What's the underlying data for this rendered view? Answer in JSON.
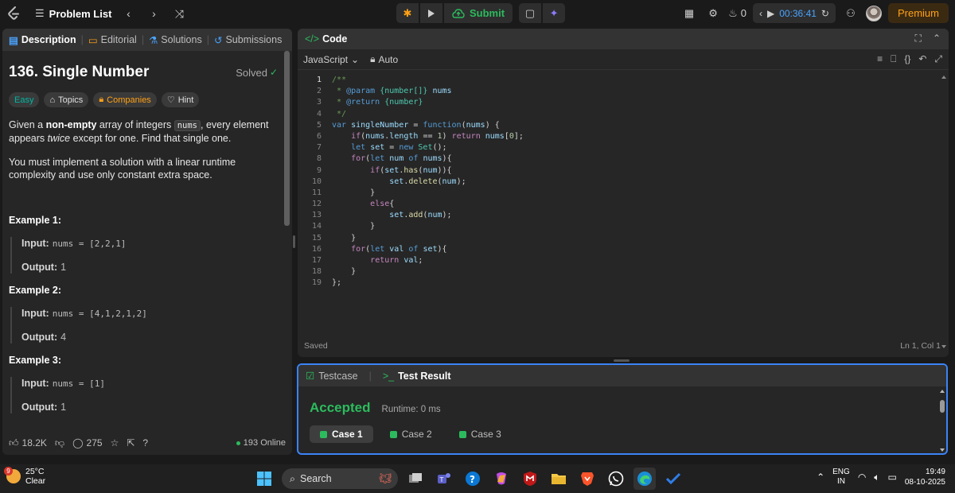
{
  "topbar": {
    "problem_list": "Problem List",
    "submit": "Submit",
    "streak": "0",
    "timer": "00:36:41",
    "premium": "Premium"
  },
  "left": {
    "tabs": [
      "Description",
      "Editorial",
      "Solutions",
      "Submissions"
    ],
    "title": "136. Single Number",
    "status": "Solved",
    "tags": [
      "Easy",
      "Topics",
      "Companies",
      "Hint"
    ],
    "desc": {
      "p1_a": "Given a ",
      "p1_bold": "non-empty",
      "p1_b": " array of integers ",
      "p1_code": "nums",
      "p1_c": ", every element appears ",
      "p1_em": "twice",
      "p1_d": " except for one. Find that single one.",
      "p2": "You must implement a solution with a linear runtime complexity and use only constant extra space."
    },
    "examples": [
      {
        "heading": "Example 1:",
        "input_label": "Input:",
        "input": "nums = [2,2,1]",
        "output_label": "Output:",
        "output": "1"
      },
      {
        "heading": "Example 2:",
        "input_label": "Input:",
        "input": "nums = [4,1,2,1,2]",
        "output_label": "Output:",
        "output": "4"
      },
      {
        "heading": "Example 3:",
        "input_label": "Input:",
        "input": "nums = [1]",
        "output_label": "Output:",
        "output": "1"
      }
    ],
    "footer": {
      "likes": "18.2K",
      "comments": "275",
      "online": "193 Online"
    }
  },
  "code": {
    "title": "Code",
    "language": "JavaScript",
    "auto": "Auto",
    "line_numbers": [
      "1",
      "2",
      "3",
      "4",
      "5",
      "6",
      "7",
      "8",
      "9",
      "10",
      "11",
      "12",
      "13",
      "14",
      "15",
      "16",
      "17",
      "18",
      "19"
    ],
    "status_saved": "Saved",
    "cursor": "Ln 1, Col 1"
  },
  "result": {
    "tabs": [
      "Testcase",
      "Test Result"
    ],
    "verdict": "Accepted",
    "runtime": "Runtime: 0 ms",
    "cases": [
      "Case 1",
      "Case 2",
      "Case 3"
    ]
  },
  "taskbar": {
    "badge": "9",
    "temp": "25°C",
    "weather": "Clear",
    "search": "Search",
    "lang1": "ENG",
    "lang2": "IN",
    "time": "19:49",
    "date": "08-10-2025"
  },
  "colors": {
    "accent_green": "#2cbb5d",
    "premium": "#ffa116",
    "easy": "#00b8a3",
    "focus_blue": "#3b83f6"
  }
}
